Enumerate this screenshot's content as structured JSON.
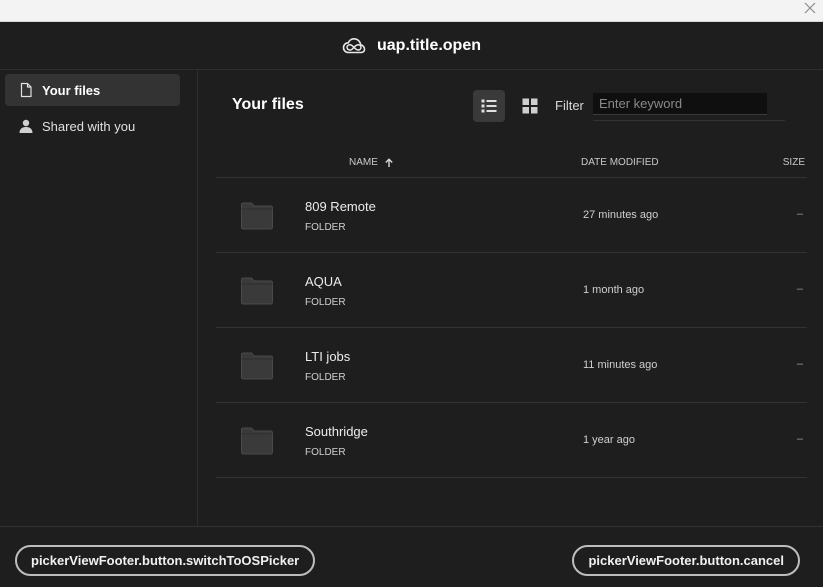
{
  "window": {
    "close_icon": "close-icon"
  },
  "header": {
    "title": "uap.title.open",
    "logo_icon": "creative-cloud-icon"
  },
  "sidebar": {
    "items": [
      {
        "label": "Your files",
        "icon": "file-icon",
        "active": true
      },
      {
        "label": "Shared with you",
        "icon": "user-icon",
        "active": false
      }
    ]
  },
  "main": {
    "title": "Your files",
    "view_modes": [
      "list-view-icon",
      "grid-view-icon"
    ],
    "filter": {
      "label": "Filter",
      "placeholder": "Enter keyword",
      "value": ""
    }
  },
  "table": {
    "columns": {
      "name": "NAME",
      "date": "DATE MODIFIED",
      "size": "SIZE"
    },
    "sort": "name-ascending",
    "rows": [
      {
        "name": "809 Remote",
        "kind": "FOLDER",
        "modified": "27 minutes ago",
        "size": "–"
      },
      {
        "name": "AQUA",
        "kind": "FOLDER",
        "modified": "1 month ago",
        "size": "–"
      },
      {
        "name": "LTI jobs",
        "kind": "FOLDER",
        "modified": "11 minutes ago",
        "size": "–"
      },
      {
        "name": "Southridge",
        "kind": "FOLDER",
        "modified": "1 year ago",
        "size": "–"
      }
    ]
  },
  "footer": {
    "switch_label": "pickerViewFooter.button.switchToOSPicker",
    "cancel_label": "pickerViewFooter.button.cancel"
  },
  "colors": {
    "background": "#1e1e1e",
    "active_nav": "#333333",
    "chrome_bar": "#f3f3f3",
    "text": "#e8e8e8"
  }
}
